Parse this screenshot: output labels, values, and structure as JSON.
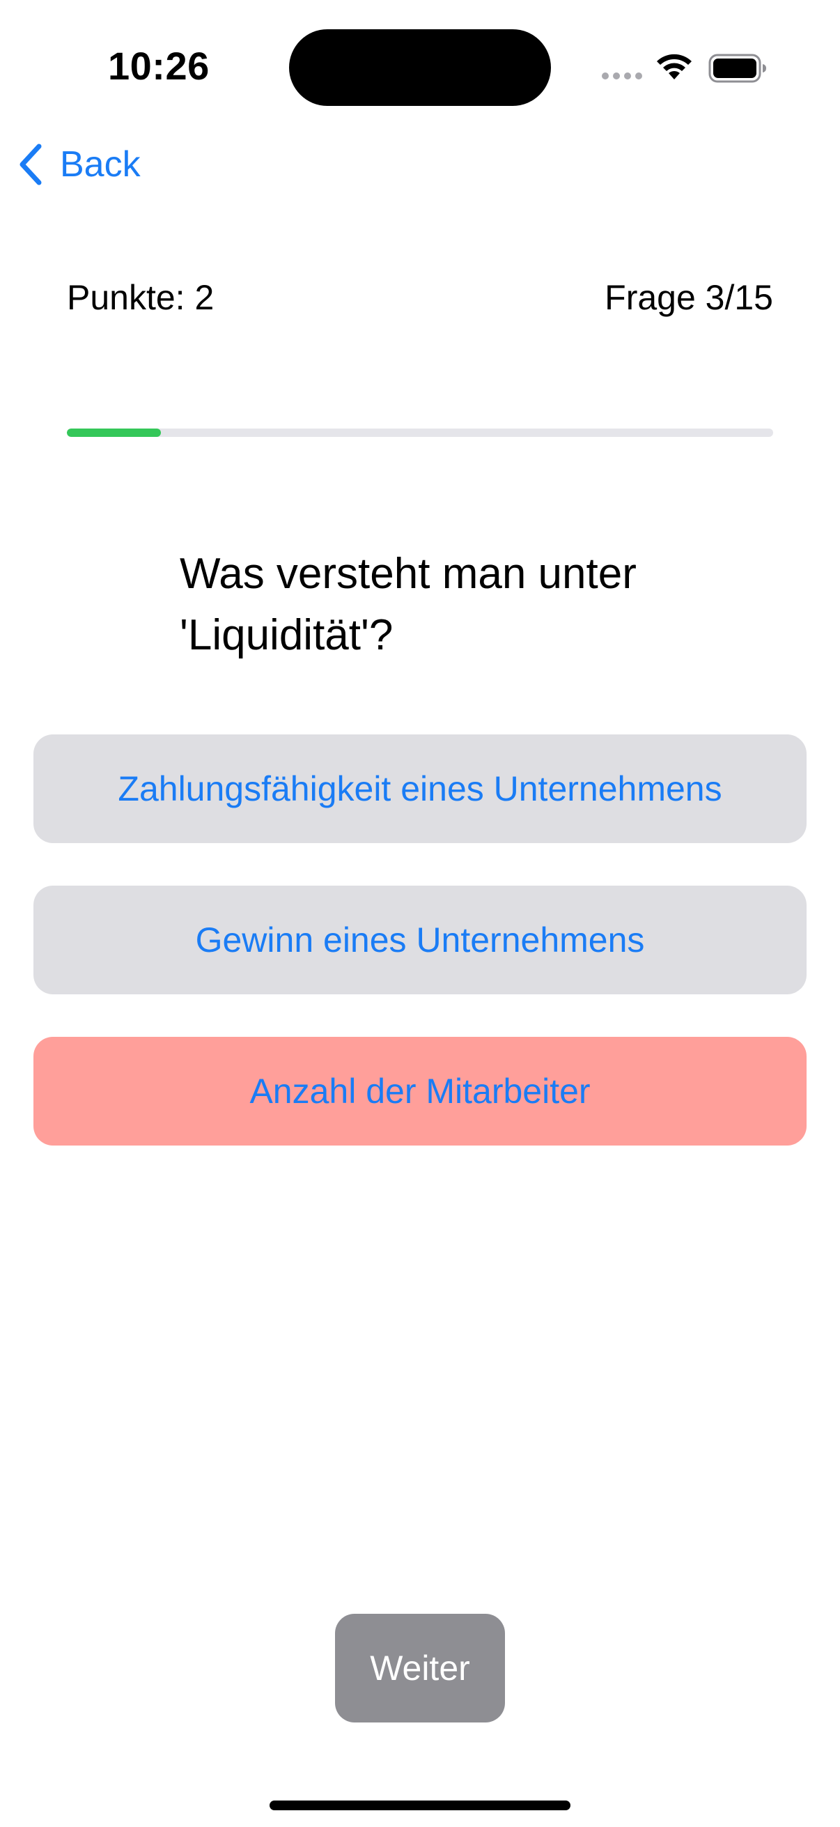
{
  "status_bar": {
    "time": "10:26"
  },
  "navigation": {
    "back_label": "Back"
  },
  "quiz": {
    "score": "Punkte: 2",
    "counter": "Frage 3/15",
    "progress_fraction": 0.133,
    "question": "Was versteht man unter 'Liquidität'?",
    "answers": [
      {
        "label": "Zahlungsfähigkeit eines Unternehmens",
        "state": "neutral"
      },
      {
        "label": "Gewinn eines Unternehmens",
        "state": "neutral"
      },
      {
        "label": "Anzahl der Mitarbeiter",
        "state": "wrong"
      }
    ],
    "next_label": "Weiter"
  },
  "colors": {
    "accent": "#1a7cf5",
    "progress": "#34c759",
    "answer_bg": "#dedee2",
    "wrong_bg": "#ff9f9a",
    "next_bg": "#8e8e93"
  }
}
